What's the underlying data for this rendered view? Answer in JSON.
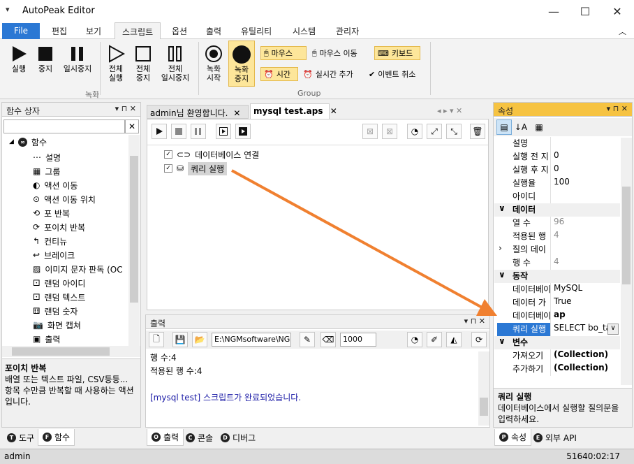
{
  "window": {
    "title": "AutoPeak Editor",
    "menu_icon": "▾"
  },
  "ribbon_tabs": [
    "File",
    "편집",
    "보기",
    "스크립트",
    "옵션",
    "출력",
    "유틸리티",
    "시스템",
    "관리자"
  ],
  "ribbon": {
    "run": "실행",
    "stop": "중지",
    "pause": "일시중지",
    "all_run": [
      "전체",
      "실행"
    ],
    "all_stop": [
      "전체",
      "중지"
    ],
    "all_pause": [
      "전체",
      "일시중지"
    ],
    "rec_start": [
      "녹화",
      "시작"
    ],
    "rec_stop": [
      "녹화",
      "중지"
    ],
    "mouse": "마우스",
    "mouse_move": "마우스 이동",
    "keyboard": "키보드",
    "time": "시간",
    "realtime_add": "실시간 추가",
    "event_cancel": "이벤트 취소",
    "group_record": "녹화",
    "group_group": "Group"
  },
  "left_panel": {
    "title": "함수 상자",
    "root": "함수",
    "items": [
      "설명",
      "그룹",
      "액션 이동",
      "액션 이동 위치",
      "포 반복",
      "포이치 반복",
      "컨티뉴",
      "브레이크",
      "이미지 문자 판독 (OC",
      "랜덤 아이디",
      "랜덤 텍스트",
      "랜덤 숫자",
      "화면 캡쳐",
      "출력"
    ],
    "desc_title": "포이치 반복",
    "desc_text": "배열 또는 텍스트 파일, CSV등등... 항목 수만큼 반복할 때 사용하는 액션입니다.",
    "tabs": [
      "도구",
      "함수"
    ]
  },
  "doc_tabs": [
    "admin님 환영합니다.",
    "mysql test.aps"
  ],
  "script": {
    "lines": [
      "데이터베이스 연결",
      "쿼리 실행"
    ]
  },
  "output": {
    "title": "출력",
    "path": "E:\\NGMsoftware\\NG",
    "count": "1000",
    "lines": [
      "행 수:4",
      "적용된 행 수:4",
      "",
      "[mysql test] 스크립트가 완료되었습니다."
    ],
    "tabs": [
      "출력",
      "콘솔",
      "디버그"
    ]
  },
  "properties": {
    "title": "속성",
    "rows": [
      {
        "type": "row",
        "k": "설명",
        "v": ""
      },
      {
        "type": "row",
        "k": "실행 전 지",
        "v": "0"
      },
      {
        "type": "row",
        "k": "실행 후 지",
        "v": "0"
      },
      {
        "type": "row",
        "k": "실행율",
        "v": "100"
      },
      {
        "type": "row",
        "k": "아이디",
        "v": ""
      },
      {
        "type": "cat",
        "k": "데이터"
      },
      {
        "type": "row",
        "k": "열 수",
        "v": "96",
        "gray": true
      },
      {
        "type": "row",
        "k": "적용된 행",
        "v": "4",
        "gray": true
      },
      {
        "type": "row",
        "k": "질의 데이",
        "v": "",
        "exp": true
      },
      {
        "type": "row",
        "k": "행 수",
        "v": "4",
        "gray": true
      },
      {
        "type": "cat",
        "k": "동작"
      },
      {
        "type": "row",
        "k": "데이터베이",
        "v": "MySQL"
      },
      {
        "type": "row",
        "k": "데이터 가",
        "v": "True"
      },
      {
        "type": "row",
        "k": "데이터베이",
        "v": "ap",
        "bold": true
      },
      {
        "type": "row",
        "k": "쿼리 실행",
        "v": "SELECT bo_tal",
        "sel": true
      },
      {
        "type": "cat",
        "k": "변수"
      },
      {
        "type": "row",
        "k": "가져오기",
        "v": "(Collection)",
        "bold": true
      },
      {
        "type": "row",
        "k": "추가하기",
        "v": "(Collection)",
        "bold": true
      }
    ],
    "desc_title": "쿼리 실행",
    "desc_text": "데이터베이스에서 실행할 질의문을 입력하세요.",
    "tabs": [
      "속성",
      "외부 API"
    ]
  },
  "status": {
    "user": "admin",
    "time": "51640:02:17"
  },
  "colors": {
    "accent": "#2b78d4",
    "highlight": "#fde69a",
    "arrow": "#f08030",
    "output_blue": "#1a1aa6"
  }
}
